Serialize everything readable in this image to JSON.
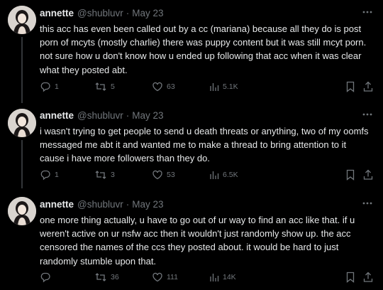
{
  "tweets": [
    {
      "name": "annette",
      "handle": "@shubluvr",
      "separator": "·",
      "date": "May 23",
      "text": "this acc has even been called out by a cc (mariana) because all they do is post porn of mcyts (mostly charlie) there was puppy content but it was still mcyt porn. not sure how u don't know how u ended up following that acc when it was clear what they posted abt.",
      "replies": "1",
      "retweets": "5",
      "likes": "63",
      "views": "5.1K"
    },
    {
      "name": "annette",
      "handle": "@shubluvr",
      "separator": "·",
      "date": "May 23",
      "text": "i wasn't trying to get people to send u death threats or anything, two of my oomfs messaged me abt it and wanted me to make a thread to bring attention to it cause i have more followers than they do.",
      "replies": "1",
      "retweets": "3",
      "likes": "53",
      "views": "6.5K"
    },
    {
      "name": "annette",
      "handle": "@shubluvr",
      "separator": "·",
      "date": "May 23",
      "text": "one more thing actually, u have to go out of ur way to find an acc like that. if u weren't active on ur nsfw acc then it wouldn't just randomly show up. the acc censored the names of the ccs they posted about. it would be hard to just randomly stumble upon that.",
      "replies": "",
      "retweets": "36",
      "likes": "111",
      "views": "14K"
    }
  ],
  "colors": {
    "background": "#000000",
    "text": "#e7e9ea",
    "muted": "#71767b",
    "divider": "#2f3336"
  },
  "icons": [
    "reply-icon",
    "retweet-icon",
    "like-icon",
    "views-icon",
    "bookmark-icon",
    "share-icon",
    "more-icon"
  ]
}
